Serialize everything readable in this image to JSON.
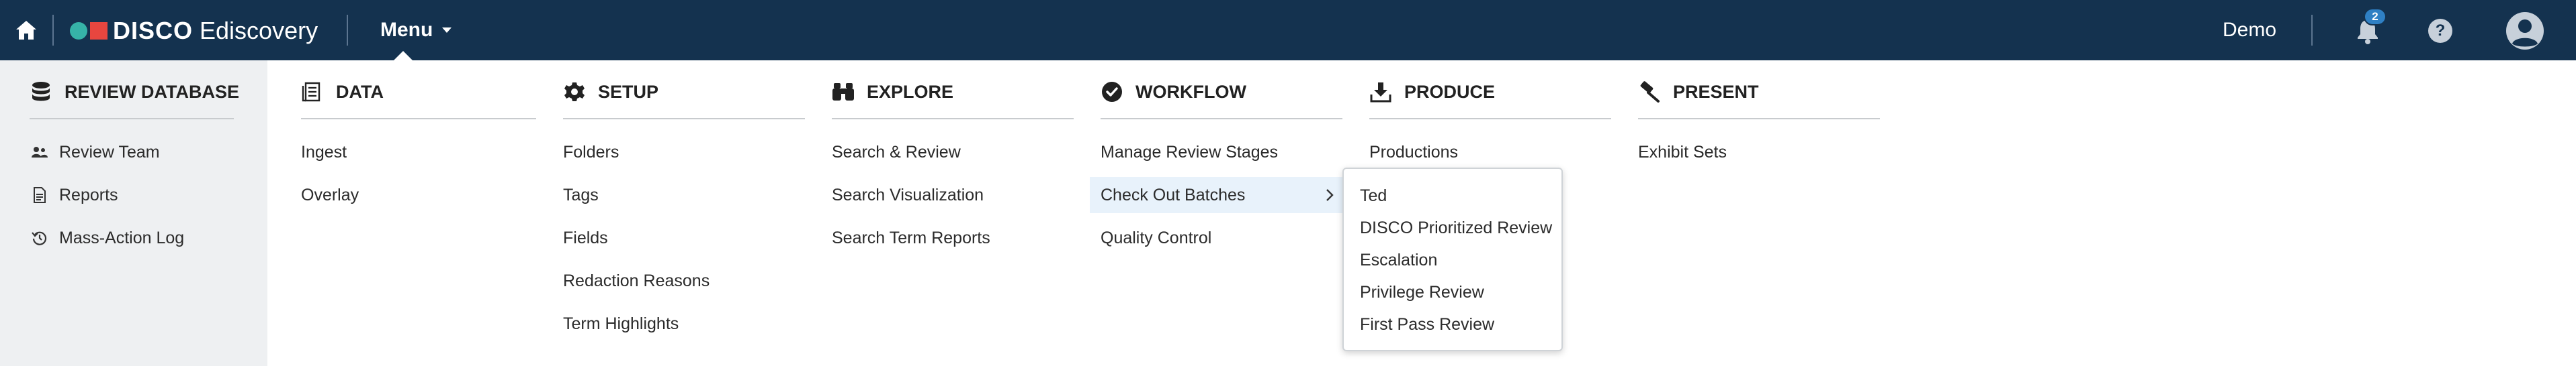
{
  "header": {
    "brand": "DISCO",
    "product": "Ediscovery",
    "menu_label": "Menu",
    "user_name": "Demo",
    "notification_count": "2",
    "help_label": "?"
  },
  "left_panel": {
    "title": "REVIEW DATABASE",
    "items": [
      {
        "label": "Review Team",
        "icon": "users-icon"
      },
      {
        "label": "Reports",
        "icon": "document-icon"
      },
      {
        "label": "Mass-Action Log",
        "icon": "history-icon"
      }
    ]
  },
  "sections": [
    {
      "title": "DATA",
      "icon": "data-icon",
      "items": [
        "Ingest",
        "Overlay"
      ]
    },
    {
      "title": "SETUP",
      "icon": "gear-icon",
      "items": [
        "Folders",
        "Tags",
        "Fields",
        "Redaction Reasons",
        "Term Highlights"
      ]
    },
    {
      "title": "EXPLORE",
      "icon": "binoculars-icon",
      "items": [
        "Search & Review",
        "Search Visualization",
        "Search Term Reports"
      ]
    },
    {
      "title": "WORKFLOW",
      "icon": "check-circle-icon",
      "items": [
        "Manage Review Stages",
        "Check Out Batches",
        "Quality Control"
      ]
    },
    {
      "title": "PRODUCE",
      "icon": "download-tray-icon",
      "items": [
        "Productions"
      ]
    },
    {
      "title": "PRESENT",
      "icon": "gavel-icon",
      "items": [
        "Exhibit Sets"
      ]
    }
  ],
  "active_item": "Check Out Batches",
  "submenu": {
    "items": [
      "Ted",
      "DISCO Prioritized Review",
      "Escalation",
      "Privilege Review",
      "First Pass Review"
    ]
  },
  "colors": {
    "topbar": "#14324f",
    "highlight": "#e8f2fb",
    "badge": "#2f80c4",
    "logo_teal": "#36b3a8",
    "logo_red": "#e8463f"
  }
}
